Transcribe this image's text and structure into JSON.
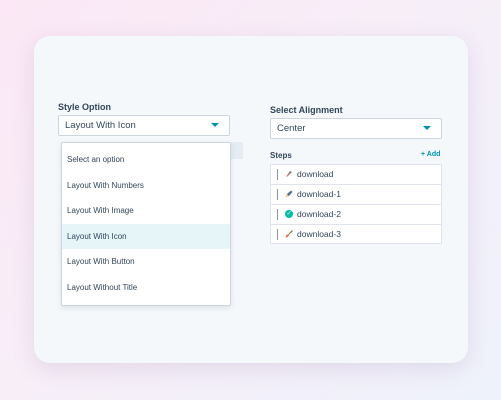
{
  "style_option": {
    "label": "Style Option",
    "value": "Layout With Icon",
    "options": [
      "Select an option",
      "Layout With Numbers",
      "Layout With Image",
      "Layout With Icon",
      "Layout With Button",
      "Layout Without Title"
    ],
    "selected_index": 3
  },
  "alignment": {
    "label": "Select Alignment",
    "value": "Center"
  },
  "steps": {
    "label": "Steps",
    "add_label": "+ Add",
    "items": [
      {
        "text": "download",
        "icon": "feather-icon"
      },
      {
        "text": "download-1",
        "icon": "pencil-icon"
      },
      {
        "text": "download-2",
        "icon": "check-circle-icon"
      },
      {
        "text": "download-3",
        "icon": "brush-icon"
      }
    ]
  },
  "colors": {
    "accent": "#0091ae",
    "selected_bg": "#e5f5f8",
    "check": "#00bda5"
  }
}
